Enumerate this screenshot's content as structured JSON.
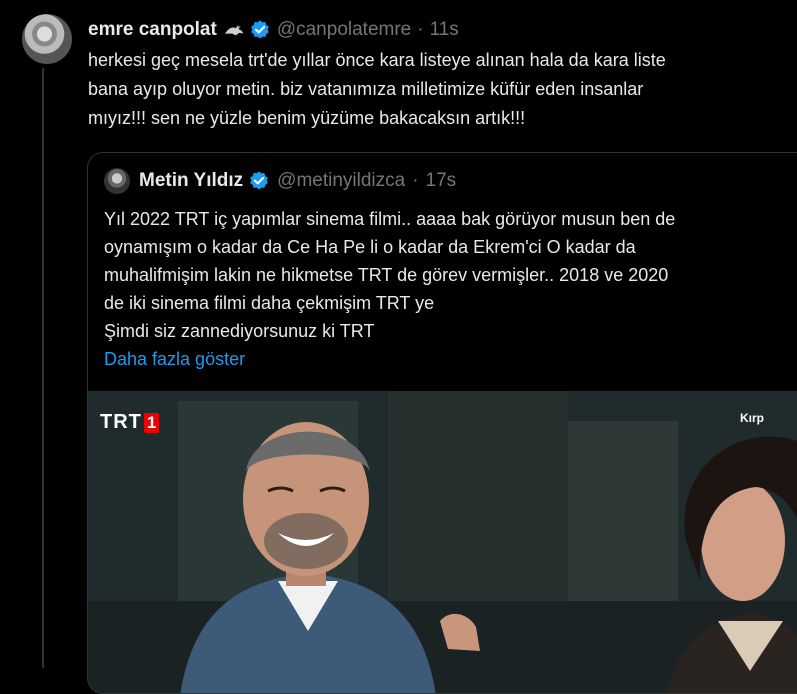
{
  "tweet": {
    "author_name": "emre canpolat",
    "handle": "@canpolatemre",
    "separator": "·",
    "time": "11s",
    "text_lines": [
      "herkesi geç mesela trt'de yıllar önce kara listeye alınan hala da kara liste",
      "bana ayıp oluyor metin. biz vatanımıza milletimize küfür eden insanlar",
      "mıyız!!!  sen ne yüzle benim yüzüme bakacaksın artık!!!"
    ]
  },
  "quote": {
    "author_name": "Metin Yıldız",
    "handle": "@metinyildizca",
    "separator": "·",
    "time": "17s",
    "text_lines": [
      "Yıl 2022 TRT iç yapımlar sinema filmi.. aaaa bak görüyor musun ben de",
      "oynamışım o kadar da Ce Ha Pe li o kadar da Ekrem'ci O kadar da",
      "muhalifmişim lakin ne hikmetse TRT de görev vermişler.. 2018 ve 2020",
      "de iki sinema filmi daha çekmişim TRT ye",
      "Şimdi siz zannediyorsunuz ki TRT"
    ],
    "show_more": "Daha fazla göster",
    "media": {
      "channel_logo_text": "TRT",
      "channel_logo_number": "1",
      "corner_label": "Kırp"
    }
  },
  "colors": {
    "background": "#000000",
    "text": "#e7e9ea",
    "muted": "#71767b",
    "link": "#1d9bf0",
    "verified": "#1d9bf0",
    "border": "#2f3336"
  },
  "icons": {
    "author_emoji": "eagle-icon",
    "verified": "verified-badge-icon"
  }
}
